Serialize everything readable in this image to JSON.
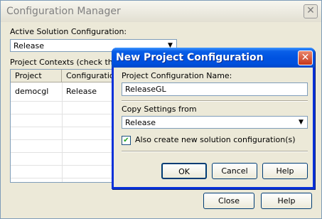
{
  "config_manager": {
    "title": "Configuration Manager",
    "active_solution_label": "Active Solution Configuration:",
    "active_solution_value": "Release",
    "project_contexts_label": "Project Contexts (check the p",
    "columns": [
      "Project",
      "Configuration"
    ],
    "rows": [
      {
        "project": "democgl",
        "configuration": "Release"
      }
    ],
    "close_button": "Close",
    "help_button": "Help"
  },
  "new_project_config": {
    "title": "New Project Configuration",
    "name_label": "Project Configuration Name:",
    "name_value": "ReleaseGL",
    "copy_settings_label": "Copy Settings from",
    "copy_settings_value": "Release",
    "also_create_label": "Also create new solution configuration(s)",
    "also_create_checked": true,
    "ok_button": "OK",
    "cancel_button": "Cancel",
    "help_button": "Help"
  }
}
